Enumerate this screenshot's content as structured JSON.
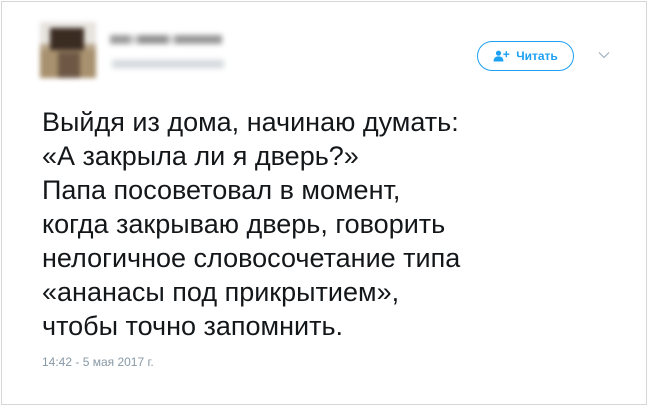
{
  "header": {
    "follow_label": "Читать",
    "icons": {
      "follow": "add-user-icon",
      "menu": "chevron-down-icon"
    }
  },
  "tweet": {
    "lines": [
      "Выйдя из дома, начинаю думать:",
      "«А закрыла ли я дверь?»",
      "Папа посоветовал в момент,",
      "когда закрываю дверь, говорить",
      "нелогичное словосочетание типа",
      "«ананасы под прикрытием»,",
      "чтобы точно запомнить."
    ],
    "timestamp": "14:42 - 5 мая 2017 г."
  },
  "colors": {
    "accent": "#1da1f2",
    "text": "#14171a",
    "muted": "#8899a6",
    "border": "#d6d6d6"
  }
}
